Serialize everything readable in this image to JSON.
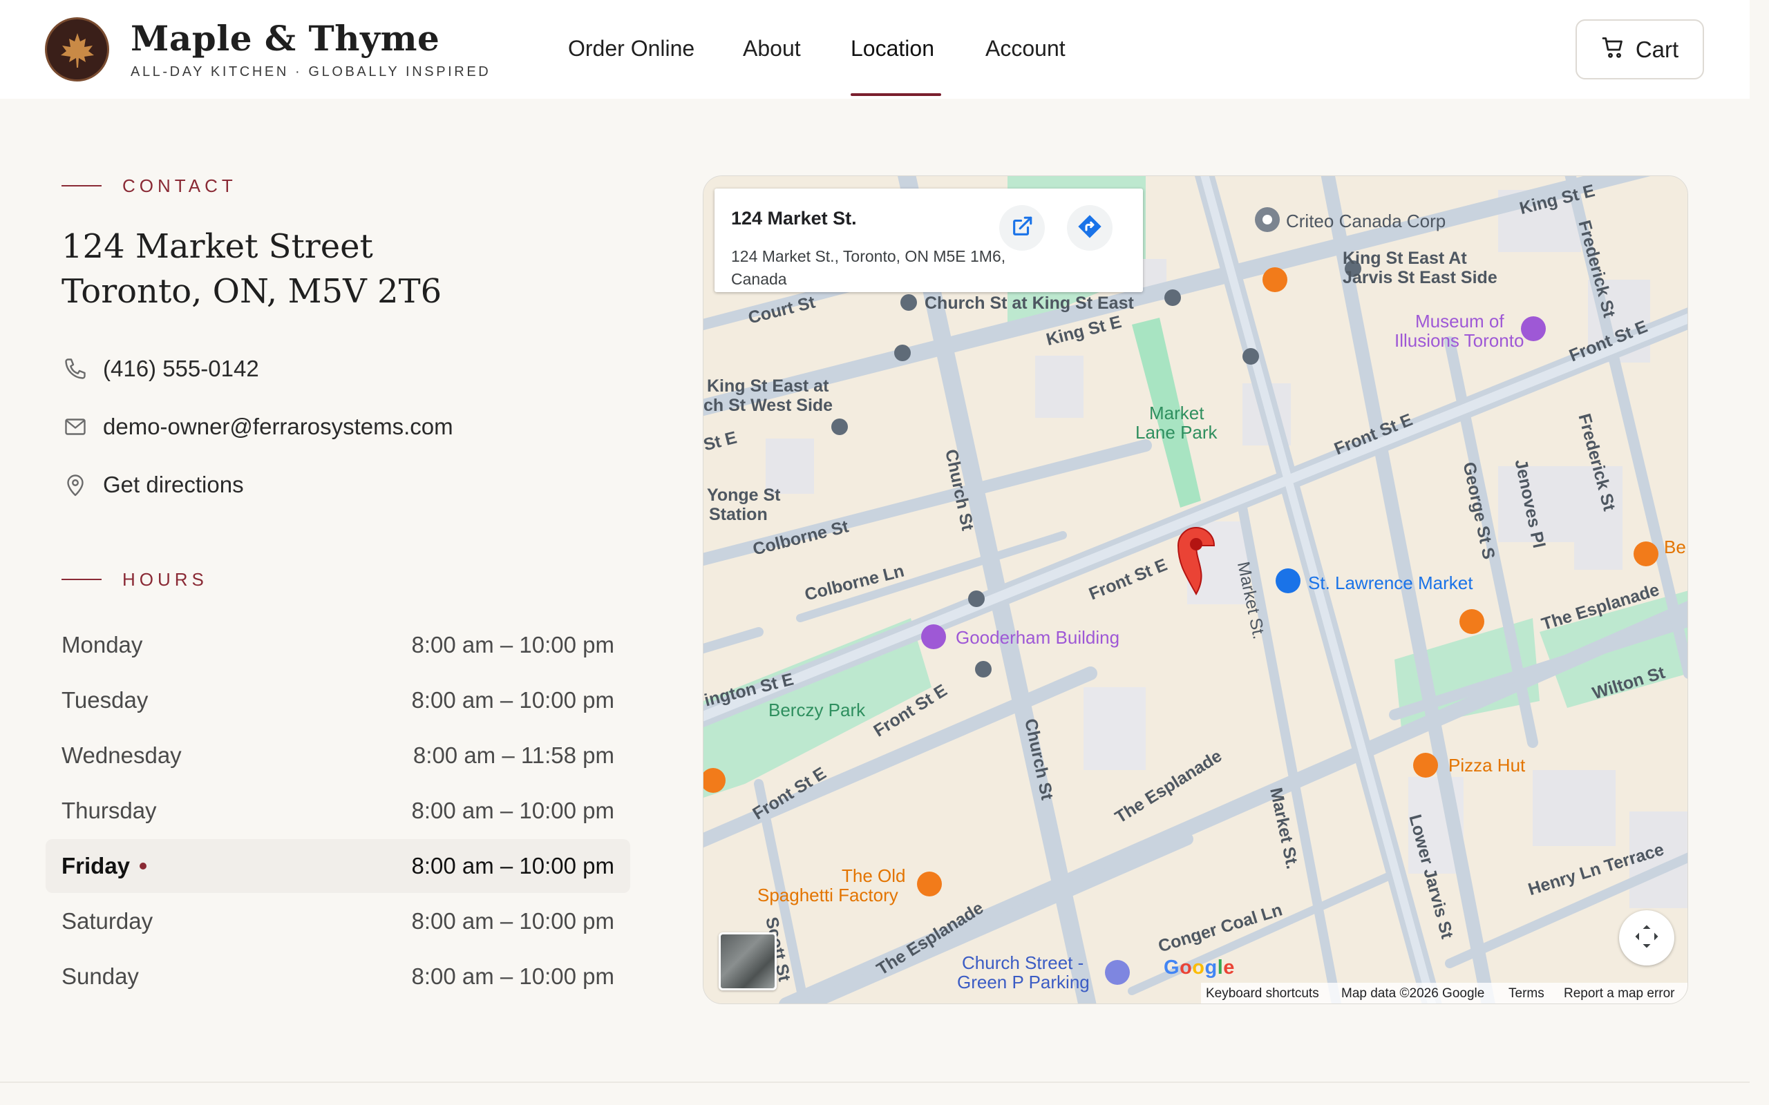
{
  "brand": {
    "name": "Maple & Thyme",
    "tagline": "ALL-DAY KITCHEN · GLOBALLY INSPIRED"
  },
  "nav": {
    "items": [
      {
        "label": "Order Online"
      },
      {
        "label": "About"
      },
      {
        "label": "Location"
      },
      {
        "label": "Account"
      }
    ],
    "active": "Location",
    "cart_label": "Cart"
  },
  "contact": {
    "section_label": "CONTACT",
    "address_line1": "124 Market Street",
    "address_line2": "Toronto, ON, M5V 2T6",
    "phone": "(416) 555-0142",
    "email": "demo-owner@ferrarosystems.com",
    "directions": "Get directions"
  },
  "hours": {
    "section_label": "HOURS",
    "rows": [
      {
        "day": "Monday",
        "time": "8:00 am – 10:00 pm"
      },
      {
        "day": "Tuesday",
        "time": "8:00 am – 10:00 pm"
      },
      {
        "day": "Wednesday",
        "time": "8:00 am – 11:58 pm"
      },
      {
        "day": "Thursday",
        "time": "8:00 am – 10:00 pm"
      },
      {
        "day": "Friday",
        "time": "8:00 am – 10:00 pm"
      },
      {
        "day": "Saturday",
        "time": "8:00 am – 10:00 pm"
      },
      {
        "day": "Sunday",
        "time": "8:00 am – 10:00 pm"
      }
    ],
    "today": "Friday"
  },
  "map": {
    "card_title": "124 Market St.",
    "card_address": "124 Market St., Toronto, ON M5E 1M6, Canada",
    "labels": {
      "criteo": "Criteo Canada Corp",
      "king_st_e_top": "King St E",
      "frederick_top": "Frederick St",
      "court_st": "Court St",
      "church_king": "Church St at King St East",
      "king_jarvis1": "King St East At",
      "king_jarvis2": "Jarvis St East Side",
      "museum1": "Museum of",
      "museum2": "Illusions Toronto",
      "king_st_e_mid": "King St E",
      "front_st_e_ne": "Front St E",
      "king_church1": "King St East at",
      "king_church2": "ch St West Side",
      "market_lane1": "Market",
      "market_lane2": "Lane Park",
      "st_e_left": "St E",
      "front_st_e_mid": "Front St E",
      "yonge1": "Yonge St",
      "yonge2": "Station",
      "church_st_mid": "Church St",
      "george": "George St S",
      "jenoves": "Jenoves Pl",
      "frederick_mid": "Frederick St",
      "colborne_st": "Colborne St",
      "colborne_ln": "Colborne Ln",
      "front_st_e_center": "Front St E",
      "market_st_center": "Market St.",
      "st_lawrence": "St. Lawrence Market",
      "be": "Be",
      "gooderham": "Gooderham Building",
      "esplanade_right": "The Esplanade",
      "wellington": "ington St E",
      "berczy": "Berczy Park",
      "front_st_e_sw": "Front St E",
      "wilton": "Wilton St",
      "church_st_low": "Church St",
      "pizza_hut": "Pizza Hut",
      "front_st_e_low": "Front St E",
      "esplanade_mid": "The Esplanade",
      "market_st_low": "Market St.",
      "lower_jarvis": "Lower Jarvis St",
      "spaghetti1": "The Old",
      "spaghetti2": "Spaghetti Factory",
      "henry": "Henry Ln Terrace",
      "conger": "Conger Coal Ln",
      "esplanade_low": "The Esplanade",
      "scott": "Scott St",
      "church_parking1": "Church Street -",
      "church_parking2": "Green P Parking"
    },
    "google_logo": "Google",
    "attribution": {
      "shortcuts": "Keyboard shortcuts",
      "data": "Map data ©2026 Google",
      "terms": "Terms",
      "report": "Report a map error"
    }
  },
  "colors": {
    "accent": "#8a2a35",
    "background": "#f9f7f3",
    "pin": "#ea4335"
  }
}
